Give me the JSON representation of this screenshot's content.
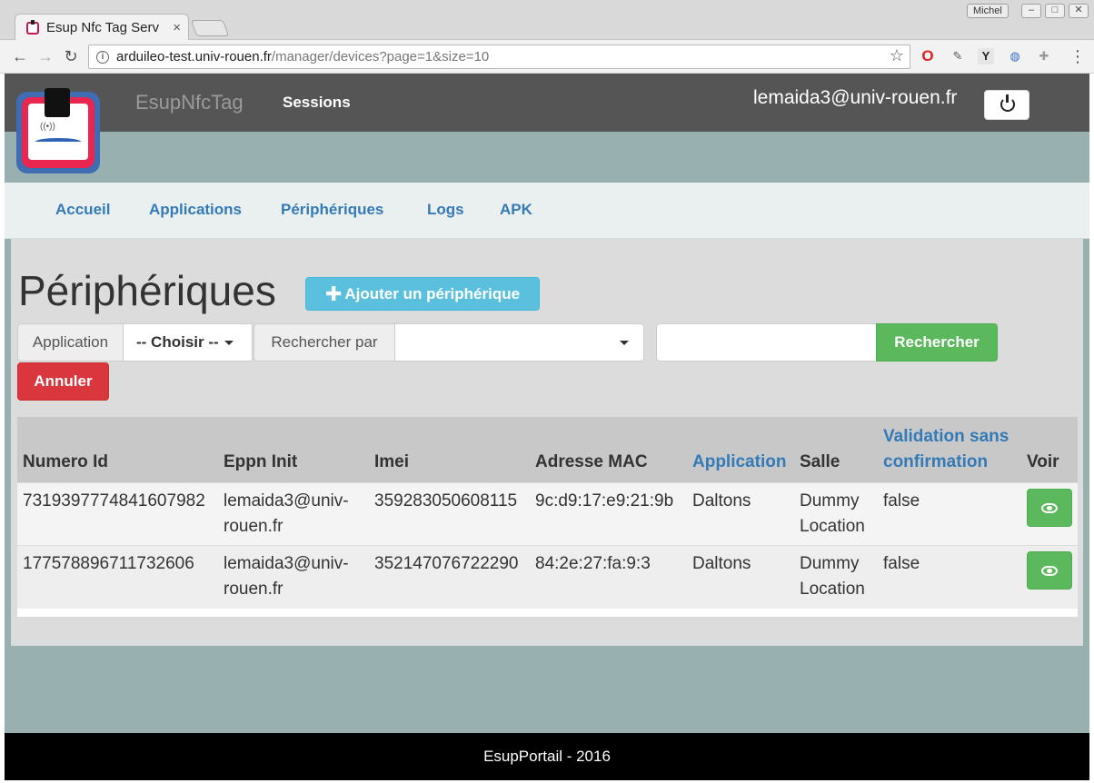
{
  "browser": {
    "user_badge": "Michel",
    "tab_title": "Esup Nfc Tag Serv",
    "tab_close": "×",
    "url_host": "arduileo-test.univ-rouen.fr",
    "url_path": "/manager/devices?page=1&size=10",
    "window_buttons": [
      "–",
      "□",
      "✕"
    ]
  },
  "header": {
    "brand": "EsupNfcTag",
    "sessions": "Sessions",
    "user_email": "lemaida3@univ-rouen.fr"
  },
  "subnav": {
    "items": [
      "Accueil",
      "Applications",
      "Périphériques",
      "Logs",
      "APK"
    ]
  },
  "main": {
    "title": "Périphériques",
    "add_button": "Ajouter un périphérique",
    "filters": {
      "application_label": "Application",
      "application_value": "-- Choisir --",
      "search_by_label": "Rechercher par",
      "search_by_value": "",
      "search_button": "Rechercher",
      "cancel_button": "Annuler"
    },
    "table": {
      "headers": [
        "Numero Id",
        "Eppn Init",
        "Imei",
        "Adresse MAC",
        "Application",
        "Salle",
        "Validation sans confirmation",
        "Voir"
      ],
      "rows": [
        [
          "7319397774841607982",
          "lemaida3@univ-rouen.fr",
          "359283050608115",
          "9c:d9:17:e9:21:9b",
          "Daltons",
          "Dummy Location",
          "false"
        ],
        [
          "177578896711732606",
          "lemaida3@univ-rouen.fr",
          "352147076722290",
          "84:2e:27:fa:9:3",
          "Daltons",
          "Dummy Location",
          "false"
        ]
      ]
    }
  },
  "footer": {
    "text": "EsupPortail - 2016"
  },
  "colors": {
    "topbar": "#555555",
    "page_bg": "#98b1b0",
    "link": "#337ab7",
    "info_button": "#5bc0de",
    "success_button": "#5cb85c",
    "danger_button": "#d9363e"
  }
}
